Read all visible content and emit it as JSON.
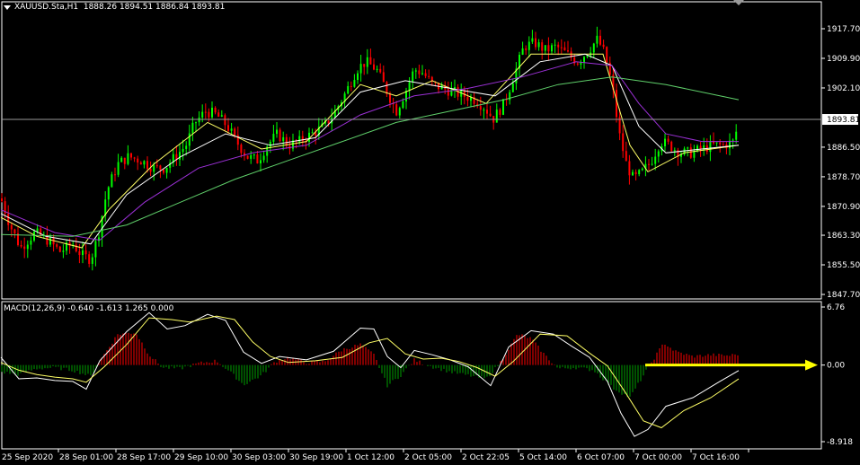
{
  "header": {
    "symbol": "XAUUSD.Sta,H1",
    "ohlc": "1888.26 1894.51 1886.84 1893.81"
  },
  "macd_header": {
    "label": "MACD(12,26,9) -0.640 -1.613 1.265 0.000"
  },
  "price_axis": {
    "ticks": [
      "1917.70",
      "1909.90",
      "1902.10",
      "1886.50",
      "1878.70",
      "1870.90",
      "1863.30",
      "1855.50",
      "1847.70"
    ],
    "current": "1893.81"
  },
  "macd_axis": {
    "ticks": [
      "6.76",
      "0.00",
      "-8.918"
    ]
  },
  "time_axis": {
    "labels": [
      "25 Sep 2020",
      "28 Sep 01:00",
      "28 Sep 17:00",
      "29 Sep 10:00",
      "30 Sep 03:00",
      "30 Sep 19:00",
      "1 Oct 12:00",
      "2 Oct 05:00",
      "2 Oct 22:05",
      "5 Oct 14:00",
      "6 Oct 07:00",
      "7 Oct 00:00",
      "7 Oct 16:00"
    ]
  },
  "chart_data": [
    {
      "type": "candlestick",
      "title": "XAUUSD.Sta,H1",
      "ylim": [
        1847.7,
        1921.5
      ],
      "bullish_color": "#00ff00",
      "bearish_color": "#ff0000",
      "close_path": [
        [
          0,
          1873
        ],
        [
          10,
          1866
        ],
        [
          22,
          1860
        ],
        [
          38,
          1864
        ],
        [
          52,
          1862
        ],
        [
          66,
          1859
        ],
        [
          80,
          1861
        ],
        [
          90,
          1858
        ],
        [
          100,
          1857
        ],
        [
          108,
          1863
        ],
        [
          118,
          1875
        ],
        [
          130,
          1882
        ],
        [
          142,
          1884
        ],
        [
          156,
          1883
        ],
        [
          170,
          1881
        ],
        [
          182,
          1881
        ],
        [
          194,
          1884
        ],
        [
          206,
          1887
        ],
        [
          216,
          1893
        ],
        [
          228,
          1896
        ],
        [
          240,
          1895
        ],
        [
          252,
          1892
        ],
        [
          262,
          1888
        ],
        [
          274,
          1884
        ],
        [
          286,
          1883
        ],
        [
          296,
          1887
        ],
        [
          308,
          1890
        ],
        [
          320,
          1887
        ],
        [
          332,
          1888
        ],
        [
          346,
          1890
        ],
        [
          360,
          1892
        ],
        [
          372,
          1896
        ],
        [
          384,
          1901
        ],
        [
          396,
          1907
        ],
        [
          406,
          1909
        ],
        [
          418,
          1907
        ],
        [
          430,
          1901
        ],
        [
          440,
          1896
        ],
        [
          450,
          1901
        ],
        [
          460,
          1907
        ],
        [
          470,
          1906
        ],
        [
          480,
          1903
        ],
        [
          492,
          1902
        ],
        [
          504,
          1901
        ],
        [
          516,
          1900
        ],
        [
          528,
          1899
        ],
        [
          538,
          1897
        ],
        [
          548,
          1894
        ],
        [
          560,
          1898
        ],
        [
          572,
          1906
        ],
        [
          582,
          1913
        ],
        [
          594,
          1914
        ],
        [
          606,
          1912
        ],
        [
          618,
          1913
        ],
        [
          630,
          1911
        ],
        [
          642,
          1909
        ],
        [
          654,
          1912
        ],
        [
          664,
          1915
        ],
        [
          672,
          1911
        ],
        [
          680,
          1903
        ],
        [
          688,
          1890
        ],
        [
          696,
          1882
        ],
        [
          704,
          1878
        ],
        [
          714,
          1880
        ],
        [
          724,
          1883
        ],
        [
          734,
          1888
        ],
        [
          744,
          1887
        ],
        [
          756,
          1885
        ],
        [
          768,
          1885
        ],
        [
          780,
          1886
        ],
        [
          792,
          1887
        ],
        [
          804,
          1887
        ],
        [
          816,
          1888
        ],
        [
          821,
          1893.81
        ]
      ],
      "moving_averages": [
        {
          "color": "#ffff66",
          "period_desc": "fast",
          "path": [
            [
              0,
              1868
            ],
            [
              40,
              1863
            ],
            [
              90,
              1860
            ],
            [
              120,
              1870
            ],
            [
              170,
              1882
            ],
            [
              230,
              1893
            ],
            [
              290,
              1886
            ],
            [
              340,
              1888
            ],
            [
              400,
              1903
            ],
            [
              440,
              1900
            ],
            [
              480,
              1904
            ],
            [
              540,
              1898
            ],
            [
              590,
              1911
            ],
            [
              640,
              1911
            ],
            [
              670,
              1911
            ],
            [
              700,
              1887
            ],
            [
              720,
              1880
            ],
            [
              760,
              1885
            ],
            [
              821,
              1887
            ]
          ]
        },
        {
          "color": "#ffffff",
          "period_desc": "medium",
          "path": [
            [
              0,
              1869
            ],
            [
              50,
              1863
            ],
            [
              100,
              1861
            ],
            [
              140,
              1874
            ],
            [
              200,
              1884
            ],
            [
              250,
              1890
            ],
            [
              300,
              1887
            ],
            [
              350,
              1889
            ],
            [
              400,
              1901
            ],
            [
              450,
              1904
            ],
            [
              500,
              1902
            ],
            [
              550,
              1900
            ],
            [
              600,
              1909
            ],
            [
              650,
              1911
            ],
            [
              680,
              1908
            ],
            [
              710,
              1892
            ],
            [
              740,
              1885
            ],
            [
              780,
              1886
            ],
            [
              821,
              1887
            ]
          ]
        },
        {
          "color": "#9b30d6",
          "period_desc": "slow",
          "path": [
            [
              0,
              1870
            ],
            [
              60,
              1864
            ],
            [
              110,
              1862
            ],
            [
              160,
              1872
            ],
            [
              220,
              1881
            ],
            [
              280,
              1885
            ],
            [
              340,
              1887
            ],
            [
              400,
              1895
            ],
            [
              460,
              1900
            ],
            [
              520,
              1902
            ],
            [
              580,
              1905
            ],
            [
              640,
              1909
            ],
            [
              680,
              1908
            ],
            [
              710,
              1898
            ],
            [
              740,
              1890
            ],
            [
              780,
              1888
            ],
            [
              821,
              1888
            ]
          ]
        },
        {
          "color": "#5fcf6a",
          "period_desc": "long",
          "path": [
            [
              0,
              1863.5
            ],
            [
              80,
              1863
            ],
            [
              140,
              1866
            ],
            [
              200,
              1872
            ],
            [
              260,
              1878
            ],
            [
              320,
              1883
            ],
            [
              380,
              1888
            ],
            [
              440,
              1893
            ],
            [
              500,
              1896
            ],
            [
              560,
              1899
            ],
            [
              620,
              1903
            ],
            [
              680,
              1905
            ],
            [
              740,
              1903
            ],
            [
              800,
              1900
            ],
            [
              821,
              1899
            ]
          ]
        }
      ],
      "current_price": 1893.81
    },
    {
      "type": "macd",
      "title": "MACD(12,26,9)",
      "params": [
        12,
        26,
        9
      ],
      "values": {
        "main": -0.64,
        "signal": -1.613,
        "histogram": 1.265,
        "level": 0.0
      },
      "ylim": [
        -8.918,
        6.76
      ],
      "positive_color": "#ff0000",
      "negative_color": "#00a000",
      "histogram_path": [
        [
          0,
          -0.8
        ],
        [
          20,
          -1.1
        ],
        [
          40,
          -0.4
        ],
        [
          60,
          -0.3
        ],
        [
          80,
          -0.6
        ],
        [
          100,
          -1.3
        ],
        [
          110,
          0.5
        ],
        [
          130,
          3.6
        ],
        [
          150,
          3.8
        ],
        [
          165,
          1.2
        ],
        [
          180,
          -0.3
        ],
        [
          200,
          -0.4
        ],
        [
          220,
          0.2
        ],
        [
          240,
          0.5
        ],
        [
          255,
          -0.8
        ],
        [
          270,
          -2.3
        ],
        [
          290,
          -1.2
        ],
        [
          305,
          0.4
        ],
        [
          320,
          0.9
        ],
        [
          340,
          0.3
        ],
        [
          360,
          0.4
        ],
        [
          380,
          1.8
        ],
        [
          400,
          2.4
        ],
        [
          415,
          1.2
        ],
        [
          430,
          -2.4
        ],
        [
          445,
          -1.2
        ],
        [
          460,
          0.6
        ],
        [
          480,
          -0.2
        ],
        [
          500,
          -0.8
        ],
        [
          520,
          -1.2
        ],
        [
          540,
          -1.6
        ],
        [
          555,
          0.2
        ],
        [
          575,
          3.6
        ],
        [
          590,
          3.1
        ],
        [
          605,
          1.2
        ],
        [
          620,
          -0.4
        ],
        [
          640,
          -0.3
        ],
        [
          660,
          -0.6
        ],
        [
          680,
          -2.6
        ],
        [
          700,
          -3.8
        ],
        [
          715,
          -1.2
        ],
        [
          725,
          0.5
        ],
        [
          738,
          2.6
        ],
        [
          750,
          1.6
        ],
        [
          770,
          1.0
        ],
        [
          790,
          1.2
        ],
        [
          810,
          1.1
        ],
        [
          821,
          1.3
        ]
      ],
      "main_path": [
        [
          0,
          0.9
        ],
        [
          20,
          -1.6
        ],
        [
          40,
          -1.5
        ],
        [
          60,
          -1.8
        ],
        [
          80,
          -1.9
        ],
        [
          95,
          -2.8
        ],
        [
          110,
          0.5
        ],
        [
          140,
          3.9
        ],
        [
          165,
          6.1
        ],
        [
          185,
          4.2
        ],
        [
          205,
          4.6
        ],
        [
          230,
          5.9
        ],
        [
          250,
          5.2
        ],
        [
          270,
          1.5
        ],
        [
          290,
          0.2
        ],
        [
          310,
          1.0
        ],
        [
          340,
          0.6
        ],
        [
          370,
          1.6
        ],
        [
          400,
          4.3
        ],
        [
          415,
          4.2
        ],
        [
          430,
          1.0
        ],
        [
          445,
          -0.3
        ],
        [
          460,
          1.7
        ],
        [
          480,
          1.2
        ],
        [
          500,
          0.6
        ],
        [
          520,
          -0.2
        ],
        [
          545,
          -2.4
        ],
        [
          565,
          2.1
        ],
        [
          590,
          4.0
        ],
        [
          615,
          3.6
        ],
        [
          635,
          2.2
        ],
        [
          655,
          0.9
        ],
        [
          675,
          -1.9
        ],
        [
          690,
          -5.6
        ],
        [
          705,
          -8.3
        ],
        [
          720,
          -7.5
        ],
        [
          740,
          -4.8
        ],
        [
          770,
          -3.8
        ],
        [
          800,
          -1.9
        ],
        [
          821,
          -0.64
        ]
      ],
      "signal_path": [
        [
          0,
          0.3
        ],
        [
          20,
          -0.6
        ],
        [
          40,
          -1.1
        ],
        [
          60,
          -1.4
        ],
        [
          80,
          -1.6
        ],
        [
          95,
          -2.0
        ],
        [
          115,
          -0.2
        ],
        [
          140,
          2.4
        ],
        [
          165,
          5.5
        ],
        [
          190,
          5.3
        ],
        [
          210,
          5.0
        ],
        [
          240,
          5.7
        ],
        [
          260,
          5.3
        ],
        [
          280,
          2.7
        ],
        [
          300,
          1.0
        ],
        [
          320,
          0.3
        ],
        [
          350,
          0.5
        ],
        [
          380,
          0.9
        ],
        [
          410,
          2.6
        ],
        [
          430,
          3.1
        ],
        [
          450,
          1.3
        ],
        [
          470,
          0.7
        ],
        [
          490,
          0.8
        ],
        [
          510,
          0.4
        ],
        [
          530,
          -0.3
        ],
        [
          550,
          -1.3
        ],
        [
          570,
          0.4
        ],
        [
          600,
          3.6
        ],
        [
          630,
          3.4
        ],
        [
          655,
          1.4
        ],
        [
          675,
          -0.1
        ],
        [
          695,
          -3.2
        ],
        [
          715,
          -6.5
        ],
        [
          735,
          -7.3
        ],
        [
          760,
          -5.3
        ],
        [
          790,
          -3.8
        ],
        [
          821,
          -1.613
        ]
      ],
      "annotation": {
        "type": "arrow",
        "color": "#ffff00",
        "at_value": 0.0
      }
    }
  ]
}
